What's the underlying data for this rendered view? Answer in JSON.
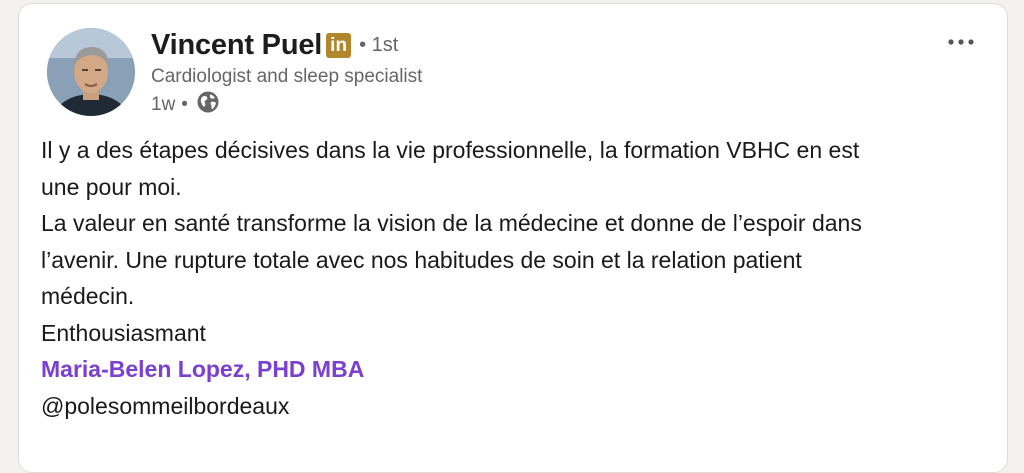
{
  "post": {
    "author": {
      "name": "Vincent Puel",
      "badge": "in",
      "degree": "• 1st",
      "headline": "Cardiologist and sleep specialist",
      "time": "1w",
      "dot": "•",
      "visibility_icon": "globe-icon"
    },
    "menu_icon": "more-horizontal-icon",
    "body_lines": [
      "Il y a des étapes décisives dans la vie professionnelle, la formation VBHC en est",
      "une pour moi.",
      "La valeur en santé transforme la vision de la médecine et donne de l’espoir dans",
      "l’avenir. Une rupture totale avec nos habitudes de soin et la relation patient",
      "médecin.",
      "Enthousiasmant"
    ],
    "mention": "Maria-Belen Lopez, PHD MBA",
    "hashtag_line": "@polesommeilbordeaux",
    "colors": {
      "mention": "#7b3fd1",
      "premium_badge": "#b0872c",
      "text": "#1a1a1a",
      "muted": "#666666"
    }
  }
}
